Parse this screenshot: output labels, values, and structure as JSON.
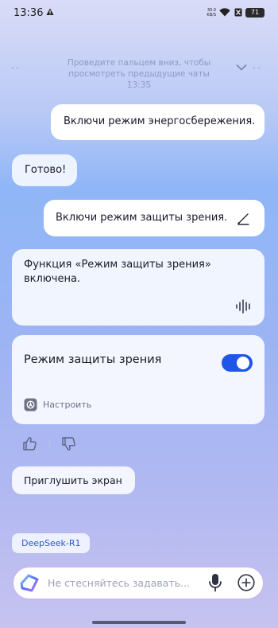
{
  "status_bar": {
    "time": "13:36",
    "net_speed_value": "30.0",
    "net_speed_unit": "KB/S",
    "battery": "71",
    "icons": [
      "alert-icon",
      "wifi-icon",
      "sim-off-icon",
      "battery-icon"
    ]
  },
  "history_hint": {
    "dash_left": "--",
    "dash_right": "--",
    "text": "Проведите пальцем вниз, чтобы просмотреть предыдущие чаты",
    "time": "13:35"
  },
  "messages": {
    "user_1": "Включи режим энергосбережения.",
    "bot_1": "Готово!",
    "user_2": "Включи режим защиты зрения.",
    "bot_2": "Функция «Режим защиты зрения» включена."
  },
  "card": {
    "title": "Режим защиты зрения",
    "toggle_on": true,
    "settings_label": "Настроить"
  },
  "suggestion": "Приглушить экран",
  "model_chip": "DeepSeek-R1",
  "input": {
    "placeholder": "Не стесняйтесь задавать...",
    "value": ""
  },
  "colors": {
    "accent": "#1f56e8",
    "model_text": "#2d56c8"
  }
}
